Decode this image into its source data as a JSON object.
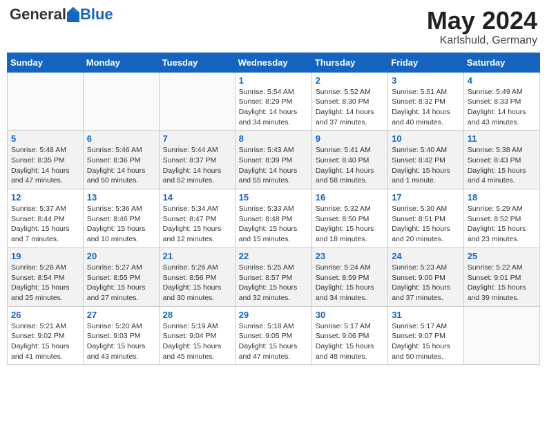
{
  "header": {
    "logo_general": "General",
    "logo_blue": "Blue",
    "month_title": "May 2024",
    "location": "Karlshuld, Germany"
  },
  "weekdays": [
    "Sunday",
    "Monday",
    "Tuesday",
    "Wednesday",
    "Thursday",
    "Friday",
    "Saturday"
  ],
  "weeks": [
    [
      {
        "day": "",
        "info": ""
      },
      {
        "day": "",
        "info": ""
      },
      {
        "day": "",
        "info": ""
      },
      {
        "day": "1",
        "info": "Sunrise: 5:54 AM\nSunset: 8:29 PM\nDaylight: 14 hours\nand 34 minutes."
      },
      {
        "day": "2",
        "info": "Sunrise: 5:52 AM\nSunset: 8:30 PM\nDaylight: 14 hours\nand 37 minutes."
      },
      {
        "day": "3",
        "info": "Sunrise: 5:51 AM\nSunset: 8:32 PM\nDaylight: 14 hours\nand 40 minutes."
      },
      {
        "day": "4",
        "info": "Sunrise: 5:49 AM\nSunset: 8:33 PM\nDaylight: 14 hours\nand 43 minutes."
      }
    ],
    [
      {
        "day": "5",
        "info": "Sunrise: 5:48 AM\nSunset: 8:35 PM\nDaylight: 14 hours\nand 47 minutes."
      },
      {
        "day": "6",
        "info": "Sunrise: 5:46 AM\nSunset: 8:36 PM\nDaylight: 14 hours\nand 50 minutes."
      },
      {
        "day": "7",
        "info": "Sunrise: 5:44 AM\nSunset: 8:37 PM\nDaylight: 14 hours\nand 52 minutes."
      },
      {
        "day": "8",
        "info": "Sunrise: 5:43 AM\nSunset: 8:39 PM\nDaylight: 14 hours\nand 55 minutes."
      },
      {
        "day": "9",
        "info": "Sunrise: 5:41 AM\nSunset: 8:40 PM\nDaylight: 14 hours\nand 58 minutes."
      },
      {
        "day": "10",
        "info": "Sunrise: 5:40 AM\nSunset: 8:42 PM\nDaylight: 15 hours\nand 1 minute."
      },
      {
        "day": "11",
        "info": "Sunrise: 5:38 AM\nSunset: 8:43 PM\nDaylight: 15 hours\nand 4 minutes."
      }
    ],
    [
      {
        "day": "12",
        "info": "Sunrise: 5:37 AM\nSunset: 8:44 PM\nDaylight: 15 hours\nand 7 minutes."
      },
      {
        "day": "13",
        "info": "Sunrise: 5:36 AM\nSunset: 8:46 PM\nDaylight: 15 hours\nand 10 minutes."
      },
      {
        "day": "14",
        "info": "Sunrise: 5:34 AM\nSunset: 8:47 PM\nDaylight: 15 hours\nand 12 minutes."
      },
      {
        "day": "15",
        "info": "Sunrise: 5:33 AM\nSunset: 8:48 PM\nDaylight: 15 hours\nand 15 minutes."
      },
      {
        "day": "16",
        "info": "Sunrise: 5:32 AM\nSunset: 8:50 PM\nDaylight: 15 hours\nand 18 minutes."
      },
      {
        "day": "17",
        "info": "Sunrise: 5:30 AM\nSunset: 8:51 PM\nDaylight: 15 hours\nand 20 minutes."
      },
      {
        "day": "18",
        "info": "Sunrise: 5:29 AM\nSunset: 8:52 PM\nDaylight: 15 hours\nand 23 minutes."
      }
    ],
    [
      {
        "day": "19",
        "info": "Sunrise: 5:28 AM\nSunset: 8:54 PM\nDaylight: 15 hours\nand 25 minutes."
      },
      {
        "day": "20",
        "info": "Sunrise: 5:27 AM\nSunset: 8:55 PM\nDaylight: 15 hours\nand 27 minutes."
      },
      {
        "day": "21",
        "info": "Sunrise: 5:26 AM\nSunset: 8:56 PM\nDaylight: 15 hours\nand 30 minutes."
      },
      {
        "day": "22",
        "info": "Sunrise: 5:25 AM\nSunset: 8:57 PM\nDaylight: 15 hours\nand 32 minutes."
      },
      {
        "day": "23",
        "info": "Sunrise: 5:24 AM\nSunset: 8:59 PM\nDaylight: 15 hours\nand 34 minutes."
      },
      {
        "day": "24",
        "info": "Sunrise: 5:23 AM\nSunset: 9:00 PM\nDaylight: 15 hours\nand 37 minutes."
      },
      {
        "day": "25",
        "info": "Sunrise: 5:22 AM\nSunset: 9:01 PM\nDaylight: 15 hours\nand 39 minutes."
      }
    ],
    [
      {
        "day": "26",
        "info": "Sunrise: 5:21 AM\nSunset: 9:02 PM\nDaylight: 15 hours\nand 41 minutes."
      },
      {
        "day": "27",
        "info": "Sunrise: 5:20 AM\nSunset: 9:03 PM\nDaylight: 15 hours\nand 43 minutes."
      },
      {
        "day": "28",
        "info": "Sunrise: 5:19 AM\nSunset: 9:04 PM\nDaylight: 15 hours\nand 45 minutes."
      },
      {
        "day": "29",
        "info": "Sunrise: 5:18 AM\nSunset: 9:05 PM\nDaylight: 15 hours\nand 47 minutes."
      },
      {
        "day": "30",
        "info": "Sunrise: 5:17 AM\nSunset: 9:06 PM\nDaylight: 15 hours\nand 48 minutes."
      },
      {
        "day": "31",
        "info": "Sunrise: 5:17 AM\nSunset: 9:07 PM\nDaylight: 15 hours\nand 50 minutes."
      },
      {
        "day": "",
        "info": ""
      }
    ]
  ]
}
